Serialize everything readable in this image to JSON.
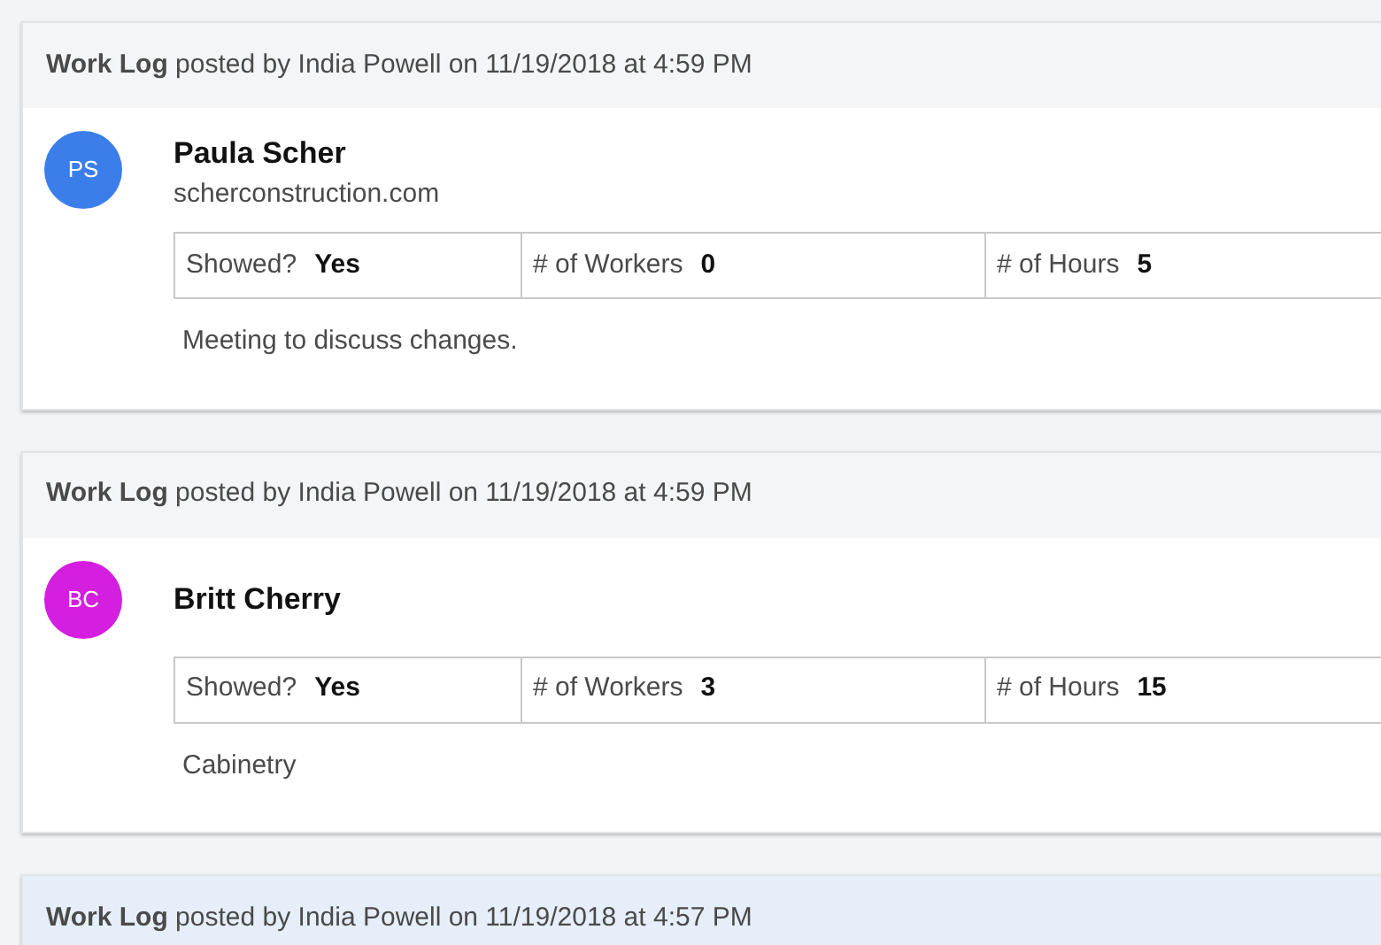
{
  "entries": [
    {
      "header": "**Work Log** posted by India Powell on 11/19/2018 at 4:59 PM",
      "highlighted": false,
      "avatar": {
        "initials": "PS",
        "color": "#3b7eea"
      },
      "name": "Paula Scher",
      "website": "scherconstruction.com",
      "fields": [
        {
          "label": "Showed?",
          "value": "Yes"
        },
        {
          "label": "# of Workers",
          "value": "0"
        },
        {
          "label": "# of Hours",
          "value": "5"
        }
      ],
      "note": "Meeting to discuss changes."
    },
    {
      "header": "**Work Log** posted by India Powell on 11/19/2018 at 4:59 PM",
      "highlighted": false,
      "avatar": {
        "initials": "BC",
        "color": "#d41fe0"
      },
      "name": "Britt Cherry",
      "fields": [
        {
          "label": "Showed?",
          "value": "Yes"
        },
        {
          "label": "# of Workers",
          "value": "3"
        },
        {
          "label": "# of Hours",
          "value": "15"
        }
      ],
      "note": "Cabinetry"
    },
    {
      "header": "**Work Log** posted by India Powell on 11/19/2018 at 4:57 PM",
      "highlighted": true
    }
  ]
}
